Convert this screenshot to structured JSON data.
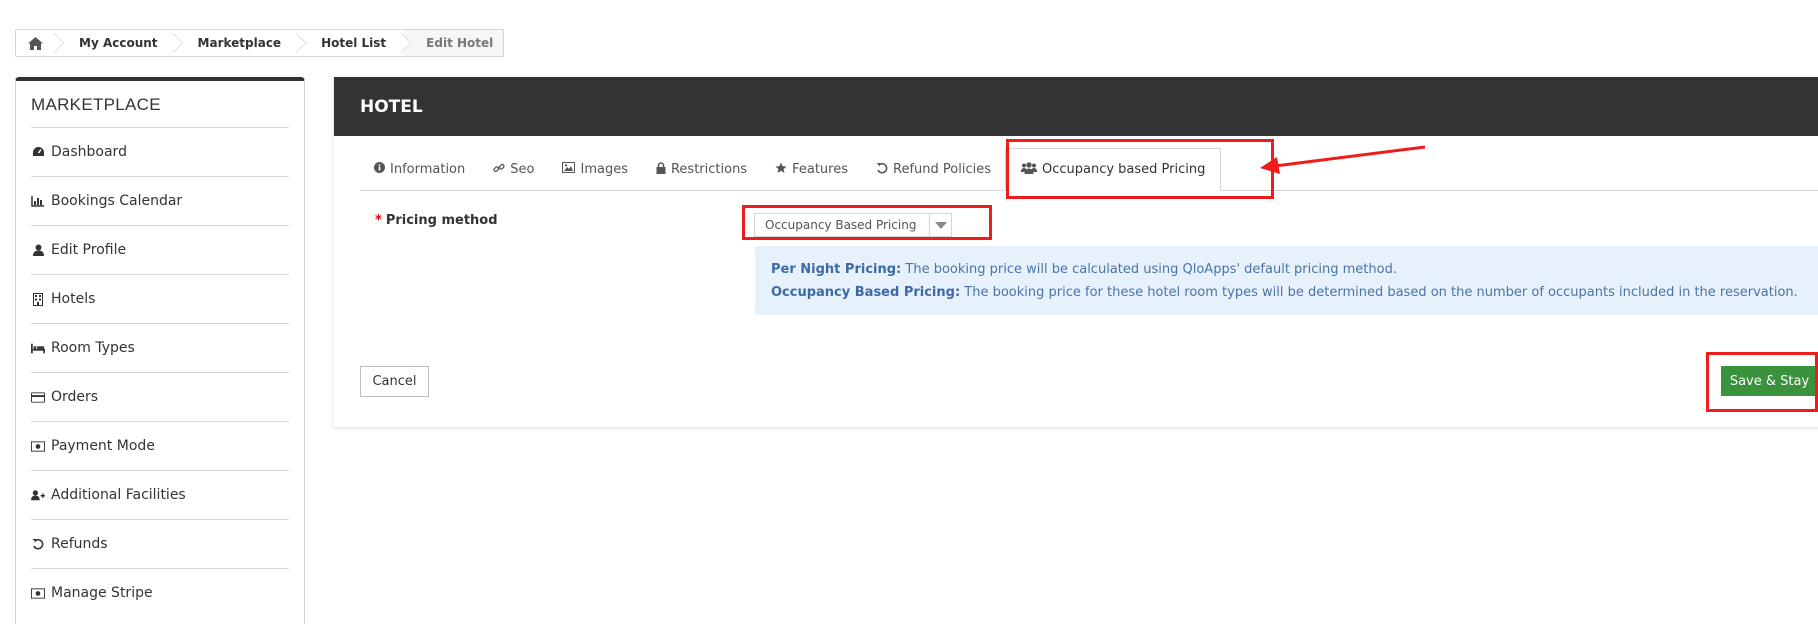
{
  "breadcrumb": {
    "items": [
      "My Account",
      "Marketplace",
      "Hotel List"
    ],
    "current": "Edit Hotel"
  },
  "sidebar": {
    "title": "MARKETPLACE",
    "items": [
      {
        "label": "Dashboard",
        "icon": "dashboard-icon"
      },
      {
        "label": "Bookings Calendar",
        "icon": "bar-chart-icon"
      },
      {
        "label": "Edit Profile",
        "icon": "user-icon"
      },
      {
        "label": "Hotels",
        "icon": "building-icon"
      },
      {
        "label": "Room Types",
        "icon": "bed-icon"
      },
      {
        "label": "Orders",
        "icon": "credit-card-icon"
      },
      {
        "label": "Payment Mode",
        "icon": "money-icon"
      },
      {
        "label": "Additional Facilities",
        "icon": "user-plus-icon"
      },
      {
        "label": "Refunds",
        "icon": "undo-icon"
      },
      {
        "label": "Manage Stripe",
        "icon": "money-icon"
      }
    ]
  },
  "panel": {
    "title": "HOTEL",
    "tabs": [
      {
        "label": "Information",
        "icon": "info-circle-icon"
      },
      {
        "label": "Seo",
        "icon": "link-icon"
      },
      {
        "label": "Images",
        "icon": "image-icon"
      },
      {
        "label": "Restrictions",
        "icon": "lock-icon"
      },
      {
        "label": "Features",
        "icon": "star-icon"
      },
      {
        "label": "Refund Policies",
        "icon": "undo-icon"
      },
      {
        "label": "Occupancy based Pricing",
        "icon": "users-icon",
        "active": true
      }
    ]
  },
  "form": {
    "pricing_label": "Pricing method",
    "required_mark": "*",
    "pricing_value": "Occupancy Based Pricing",
    "info": {
      "per_night_title": "Per Night Pricing:",
      "per_night_text": " The booking price will be calculated using QloApps' default pricing method.",
      "occupancy_title": "Occupancy Based Pricing:",
      "occupancy_text": " The booking price for these hotel room types will be determined based on the number of occupants included in the reservation."
    }
  },
  "buttons": {
    "cancel": "Cancel",
    "save_stay": "Save & Stay"
  },
  "colors": {
    "header_bg": "#333234",
    "save_green": "#3a923d",
    "info_bg": "#e6f1fc",
    "annotation_red": "#ee1c1c"
  }
}
